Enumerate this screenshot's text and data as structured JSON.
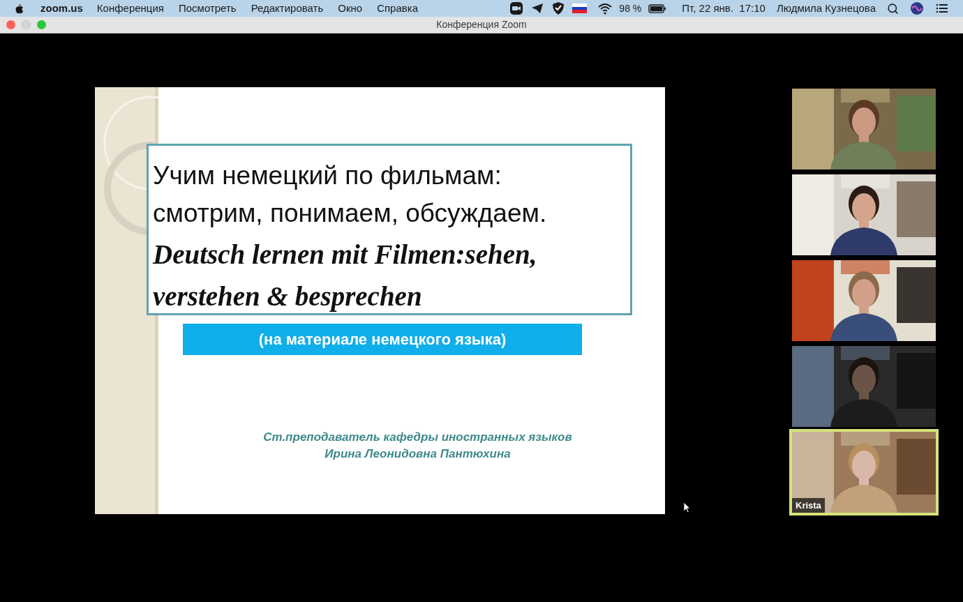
{
  "menubar": {
    "app_name": "zoom.us",
    "menu_items": [
      "Конференция",
      "Посмотреть",
      "Редактировать",
      "Окно",
      "Справка"
    ],
    "battery": "98 %",
    "clock": "Пт, 22 янв.  17:10",
    "user": "Людмила Кузнецова"
  },
  "window": {
    "title": "Конференция Zoom"
  },
  "slide": {
    "title_lines": [
      "Учим немецкий по фильмам:",
      "смотрим, понимаем, обсуждаем."
    ],
    "script_lines": [
      "Deutsch lernen mit Filmen:sehen,",
      "verstehen & besprechen"
    ],
    "banner": "(на материале немецкого языка)",
    "author_lines": [
      "Ст.преподаватель  кафедры иностранных языков",
      "Ирина Леонидовна Пантюхина"
    ]
  },
  "participants": [
    {
      "selected": false
    },
    {
      "selected": false
    },
    {
      "selected": false
    },
    {
      "selected": false
    },
    {
      "selected": true,
      "name": "Krista"
    }
  ]
}
